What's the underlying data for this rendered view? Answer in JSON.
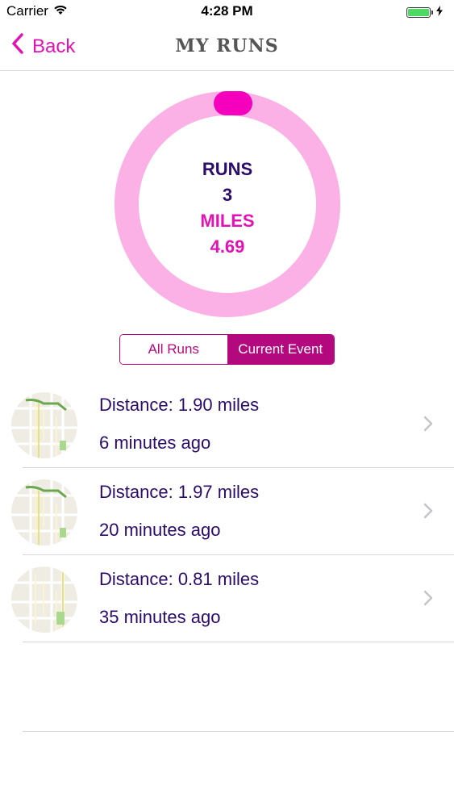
{
  "status_bar": {
    "carrier": "Carrier",
    "time": "4:28 PM",
    "battery_color": "#4cd964"
  },
  "nav": {
    "back_label": "Back",
    "title": "MY RUNS",
    "accent_color": "#e312b4"
  },
  "summary": {
    "runs_label": "RUNS",
    "runs_value": "3",
    "miles_label": "MILES",
    "miles_value": "4.69",
    "ring_color": "#fbb0e6",
    "indicator_color": "#f400bd"
  },
  "segmented": {
    "options": [
      "All Runs",
      "Current Event"
    ],
    "selected": "Current Event",
    "color": "#b4087f"
  },
  "runs": [
    {
      "distance": "Distance: 1.90 miles",
      "time": "6 minutes ago",
      "icon": "map-thumbnail-icon"
    },
    {
      "distance": "Distance: 1.97 miles",
      "time": "20 minutes ago",
      "icon": "map-thumbnail-icon"
    },
    {
      "distance": "Distance: 0.81 miles",
      "time": "35 minutes ago",
      "icon": "map-thumbnail-icon"
    }
  ]
}
